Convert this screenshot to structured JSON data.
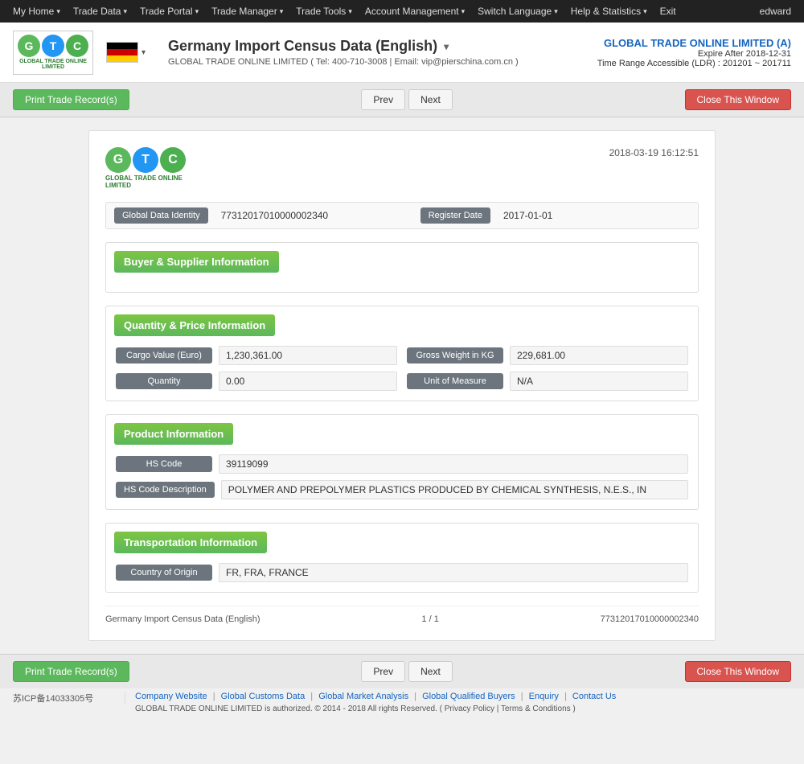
{
  "topnav": {
    "items": [
      {
        "label": "My Home",
        "hasArrow": true
      },
      {
        "label": "Trade Data",
        "hasArrow": true
      },
      {
        "label": "Trade Portal",
        "hasArrow": true
      },
      {
        "label": "Trade Manager",
        "hasArrow": true
      },
      {
        "label": "Trade Tools",
        "hasArrow": true
      },
      {
        "label": "Account Management",
        "hasArrow": true
      },
      {
        "label": "Switch Language",
        "hasArrow": true
      },
      {
        "label": "Help & Statistics",
        "hasArrow": true
      },
      {
        "label": "Exit",
        "hasArrow": false
      }
    ],
    "username": "edward"
  },
  "header": {
    "logo": {
      "letters": [
        "G",
        "T",
        "C"
      ],
      "subtitle": "GLOBAL TRADE ONLINE LIMITED"
    },
    "flag": {
      "country": "Germany",
      "colors": [
        "black",
        "red",
        "yellow"
      ]
    },
    "page_title": "Germany Import Census Data (English)",
    "subtitle": "GLOBAL TRADE ONLINE LIMITED ( Tel: 400-710-3008  |  Email: vip@pierschina.com.cn )",
    "company_name": "GLOBAL TRADE ONLINE LIMITED (A)",
    "expire_label": "Expire After 2018-12-31",
    "time_range_label": "Time Range Accessible (LDR) : 201201 ~ 201711"
  },
  "toolbar_top": {
    "print_label": "Print Trade Record(s)",
    "prev_label": "Prev",
    "next_label": "Next",
    "close_label": "Close This Window"
  },
  "record": {
    "timestamp": "2018-03-19 16:12:51",
    "global_data_identity_label": "Global Data Identity",
    "global_data_identity_value": "77312017010000002340",
    "register_date_label": "Register Date",
    "register_date_value": "2017-01-01",
    "sections": {
      "buyer_supplier": {
        "title": "Buyer & Supplier Information",
        "fields": []
      },
      "quantity_price": {
        "title": "Quantity & Price Information",
        "rows": [
          {
            "left_label": "Cargo Value (Euro)",
            "left_value": "1,230,361.00",
            "right_label": "Gross Weight in KG",
            "right_value": "229,681.00"
          },
          {
            "left_label": "Quantity",
            "left_value": "0.00",
            "right_label": "Unit of Measure",
            "right_value": "N/A"
          }
        ]
      },
      "product": {
        "title": "Product Information",
        "rows": [
          {
            "label": "HS Code",
            "value": "39119099"
          },
          {
            "label": "HS Code Description",
            "value": "POLYMER AND PREPOLYMER PLASTICS PRODUCED BY CHEMICAL SYNTHESIS, N.E.S., IN"
          }
        ]
      },
      "transportation": {
        "title": "Transportation Information",
        "rows": [
          {
            "label": "Country of Origin",
            "value": "FR, FRA, FRANCE"
          }
        ]
      }
    },
    "footer": {
      "left": "Germany Import Census Data (English)",
      "center": "1 / 1",
      "right": "77312017010000002340"
    }
  },
  "toolbar_bottom": {
    "print_label": "Print Trade Record(s)",
    "prev_label": "Prev",
    "next_label": "Next",
    "close_label": "Close This Window"
  },
  "site_footer": {
    "icp": "苏ICP备14033305号",
    "links": [
      "Company Website",
      "Global Customs Data",
      "Global Market Analysis",
      "Global Qualified Buyers",
      "Enquiry",
      "Contact Us"
    ],
    "copyright": "GLOBAL TRADE ONLINE LIMITED is authorized. © 2014 - 2018 All rights Reserved.  (  Privacy Policy  |  Terms & Conditions  )"
  }
}
